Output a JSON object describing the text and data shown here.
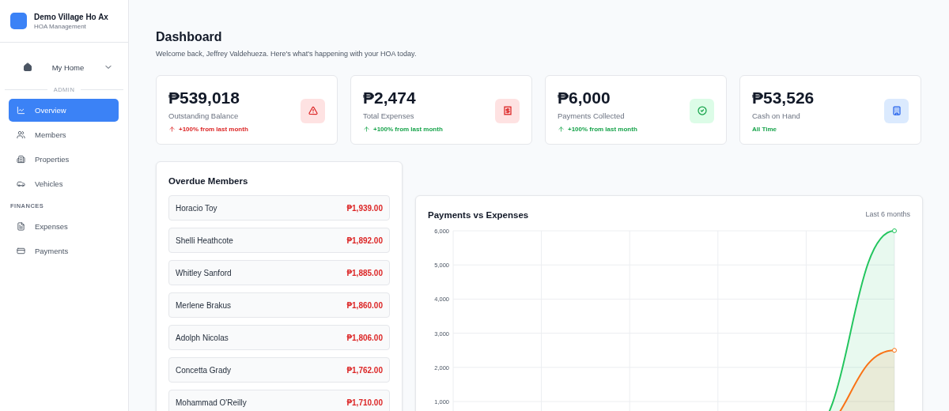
{
  "brand": {
    "name": "Demo Village Ho Ax",
    "subtitle": "HOA Management"
  },
  "home": {
    "label": "My Home",
    "expanded": false
  },
  "sidebar": [
    {
      "kind": "divider",
      "label": "ADMIN"
    },
    {
      "kind": "item",
      "label": "Overview",
      "selected": true
    },
    {
      "kind": "item",
      "label": "Members",
      "selected": false
    },
    {
      "kind": "item",
      "label": "Properties",
      "selected": false
    },
    {
      "kind": "item",
      "label": "Vehicles",
      "selected": false
    },
    {
      "kind": "section",
      "label": "FINANCES"
    },
    {
      "kind": "item",
      "label": "Expenses",
      "selected": false
    },
    {
      "kind": "item",
      "label": "Payments",
      "selected": false
    }
  ],
  "header": {
    "title": "Dashboard",
    "subtitle": "Welcome back, Jeffrey Valdehueza. Here's what's happening with your HOA today."
  },
  "stats": [
    {
      "kind": "balance",
      "value": "₱539,018",
      "label": "Outstanding Balance",
      "note": "+100% from last month"
    },
    {
      "kind": "expenses",
      "value": "₱2,474",
      "label": "Total Expenses",
      "note": "+100% from last month"
    },
    {
      "kind": "payments",
      "value": "₱6,000",
      "label": "Payments Collected",
      "note": "+100% from last month"
    },
    {
      "kind": "cash",
      "value": "₱53,526",
      "label": "Cash on Hand",
      "note": "All Time"
    }
  ],
  "overdue": {
    "title": "Overdue Members",
    "members": [
      {
        "name": "Horacio Toy",
        "amount": "₱1,939.00"
      },
      {
        "name": "Shelli Heathcote",
        "amount": "₱1,892.00"
      },
      {
        "name": "Whitley Sanford",
        "amount": "₱1,885.00"
      },
      {
        "name": "Merlene Brakus",
        "amount": "₱1,860.00"
      },
      {
        "name": "Adolph Nicolas",
        "amount": "₱1,806.00"
      },
      {
        "name": "Concetta Grady",
        "amount": "₱1,762.00"
      },
      {
        "name": "Mohammad O'Reilly",
        "amount": "₱1,710.00"
      }
    ]
  },
  "chart": {
    "title": "Payments vs Expenses",
    "range": "Last 6 months",
    "chart_data": {
      "type": "area",
      "grid": true,
      "ylim": [
        0,
        6000
      ],
      "yticks": [
        {
          "value": 1000,
          "label": "1,000"
        },
        {
          "value": 2000,
          "label": "2,000"
        },
        {
          "value": 3000,
          "label": "3,000"
        },
        {
          "value": 4000,
          "label": "4,000"
        },
        {
          "value": 5000,
          "label": "5,000"
        },
        {
          "value": 6000,
          "label": "6,000"
        }
      ],
      "series": [
        {
          "color": "#22c55e",
          "values": [
            0,
            0,
            0,
            0,
            0,
            6000
          ]
        },
        {
          "color": "#f97316",
          "values": [
            0,
            0,
            0,
            0,
            0,
            2500
          ]
        }
      ]
    }
  }
}
